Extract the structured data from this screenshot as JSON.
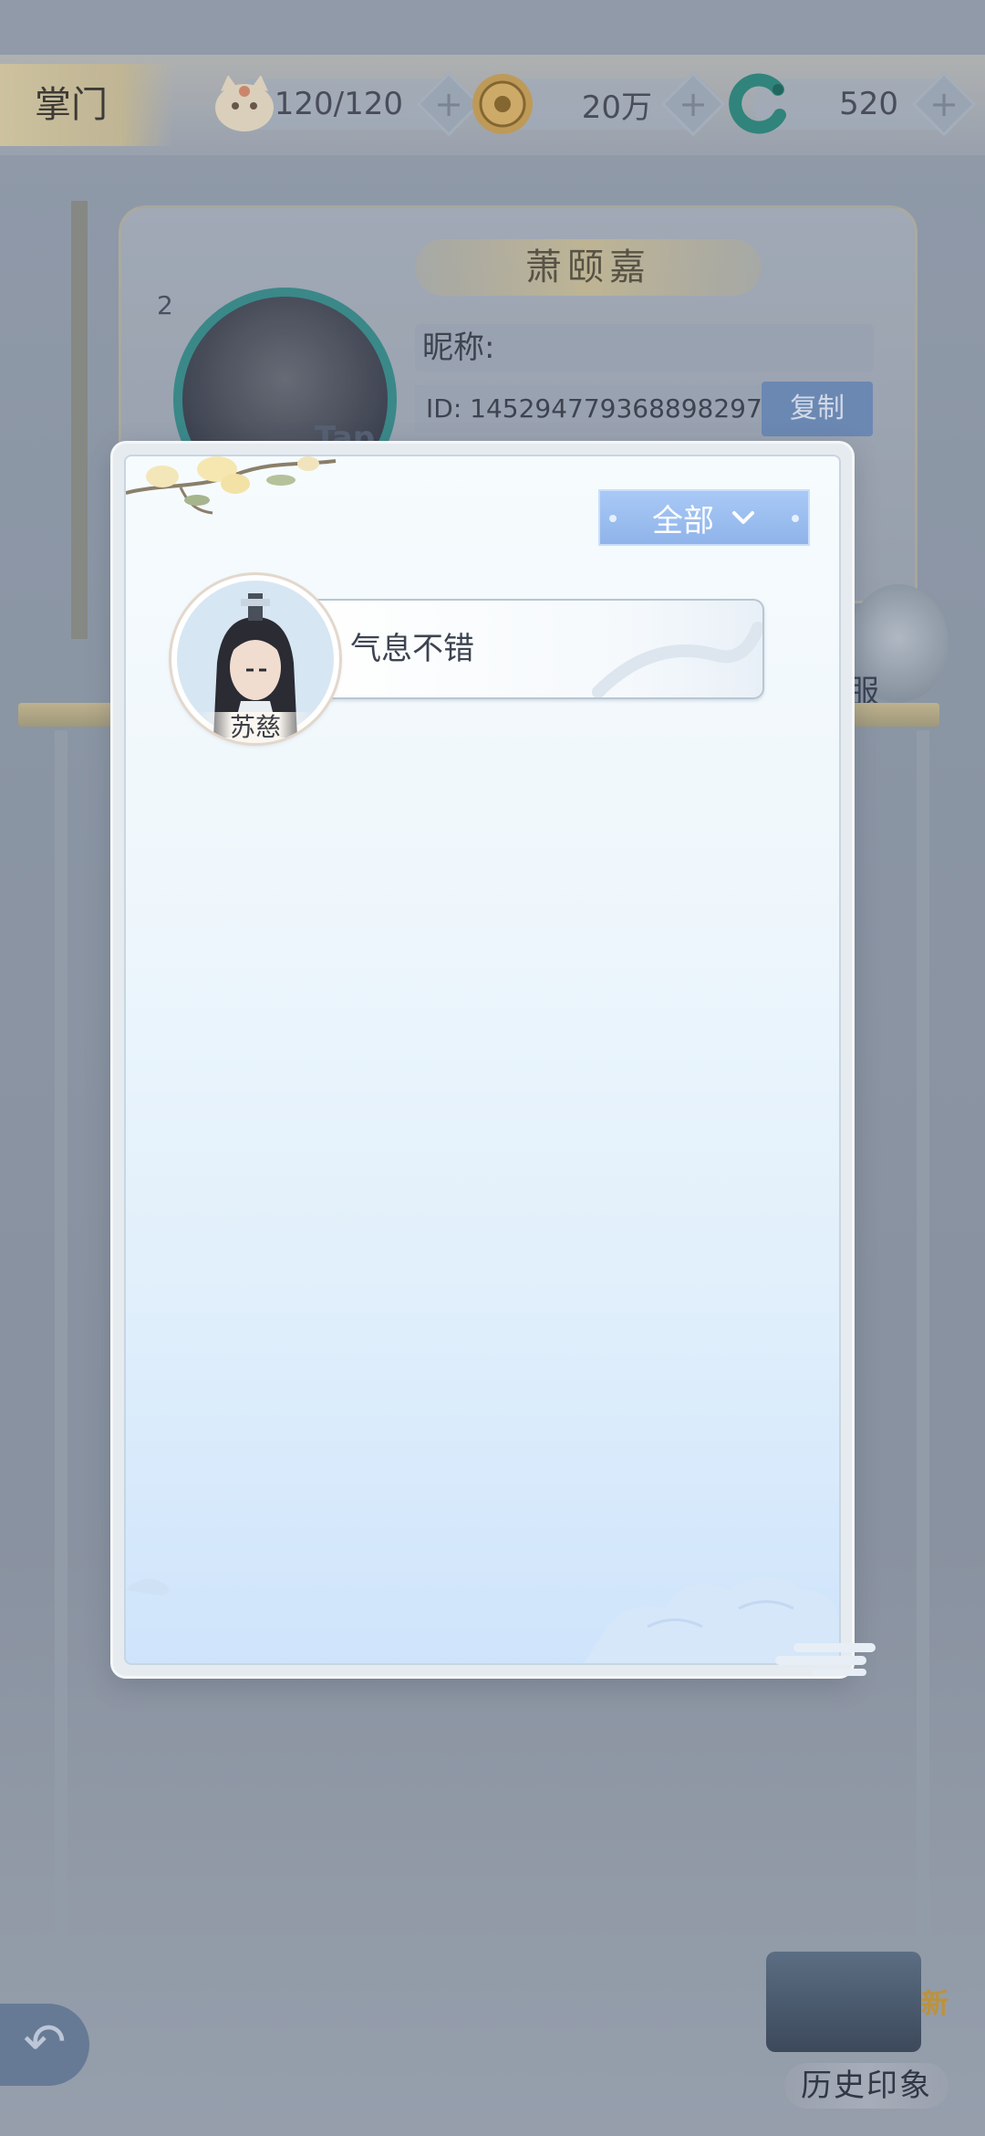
{
  "header": {
    "tab_label": "掌门",
    "resources": [
      {
        "icon": "cat-stamina-icon",
        "value": "120/120"
      },
      {
        "icon": "coin-icon",
        "value": "20万"
      },
      {
        "icon": "jade-icon",
        "value": "520"
      }
    ],
    "plus_symbol": "+"
  },
  "profile": {
    "name": "萧颐嘉",
    "level": "2",
    "nickname_label": "昵称:",
    "id_text": "ID: 145294779368898297",
    "copy_label": "复制",
    "avatar_tab_label": "Tap",
    "side_character_label": "服"
  },
  "modal": {
    "filter": {
      "selected": "全部",
      "icon": "chevron-down-icon"
    },
    "comments": [
      {
        "author": "苏慈",
        "text": "气息不错"
      }
    ]
  },
  "footer": {
    "back_icon": "back-arrow-icon",
    "back_symbol": "↶",
    "history_label": "历史印象",
    "history_badge": "新"
  },
  "colors": {
    "filter_button": "#9dbff0",
    "modal_bg": "#eff7fc",
    "bubble_border": "#b9c6d2"
  }
}
